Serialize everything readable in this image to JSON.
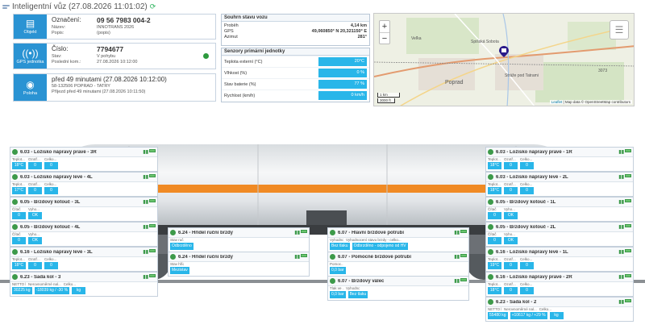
{
  "header": {
    "title": "Inteligentní vůz (27.08.2026 11:01:02)"
  },
  "wagon_info": {
    "tile_label": "Objekt",
    "main_key": "Označení:",
    "main_value": "09 56 7983 004-2",
    "rows": [
      {
        "key": "Název:",
        "value": "INNOTRANS 2026"
      },
      {
        "key": "Popis:",
        "value": "(popis)"
      }
    ]
  },
  "gps_info": {
    "tile_label": "GPS jednotka",
    "main_key": "Číslo:",
    "main_value": "7794677",
    "rows": [
      {
        "key": "Stav:",
        "value": "V pohybu"
      },
      {
        "key": "Poslední kom.:",
        "value": "27.08.2026 10:12:00"
      }
    ],
    "status_color": "#2d9a3d"
  },
  "position_info": {
    "tile_label": "Poloha",
    "main_value": "před 49 minutami (27.08.2026 10:12:00)",
    "rows": [
      {
        "value": "58-132506 POPRAD - TATRY"
      },
      {
        "value": "Příjezd před 49 minutami (27.08.2026 10:11:50)"
      }
    ]
  },
  "summary": {
    "title": "Souhrn stavu vozu",
    "rows": [
      {
        "key": "Proběh",
        "value": "4,14 km"
      },
      {
        "key": "GPS",
        "value": "49,060850° N 20,321150° E"
      },
      {
        "key": "Azimut",
        "value": "281°"
      }
    ]
  },
  "sensors": {
    "title": "Senzory primární jednotky",
    "rows": [
      {
        "key": "Teplota externí (°C)",
        "value": "20°C"
      },
      {
        "key": "Vlhkost (%)",
        "value": "0 %"
      },
      {
        "key": "Stav baterie (%)",
        "value": "77 %"
      },
      {
        "key": "Rychlost (km/h)",
        "value": "0 km/h"
      }
    ]
  },
  "map": {
    "zoom_in": "+",
    "zoom_out": "−",
    "labels": [
      "Veľka",
      "Spišská Sobota",
      "Poprad",
      "Stráže pod Tatrami",
      "3073"
    ],
    "scale_km": "1 km",
    "scale_ft": "3000 ft",
    "attrib_leaflet": "Leaflet",
    "attrib_rest": " | Map data © OpenStreetMap contributors"
  },
  "left_cards": [
    {
      "title": "6.03 - Ložisko nápravy pravé - 3R",
      "labels": [
        "Teplot...",
        "Ozotř...",
        "Celko..."
      ],
      "values": [
        "18°C",
        "0",
        "0"
      ]
    },
    {
      "title": "6.03 - Ložisko nápravy levé - 4L",
      "labels": [
        "Teplot...",
        "Ozotř...",
        "Celko..."
      ],
      "values": [
        "17°C",
        "0",
        "0"
      ]
    },
    {
      "title": "6.05 - Brzdový kotouč - 3L",
      "labels": [
        "Čítač",
        "Vyho..."
      ],
      "values": [
        "0",
        "OK"
      ]
    },
    {
      "title": "6.05 - Brzdový kotouč - 4L",
      "labels": [
        "Čítač",
        "Vyho..."
      ],
      "values": [
        "0",
        "OK"
      ]
    },
    {
      "title": "6.16 - Ložisko nápravy levé - 3L",
      "labels": [
        "Teplot...",
        "Ozotř...",
        "Celko..."
      ],
      "values": [
        "18°C",
        "0",
        "0"
      ]
    },
    {
      "title": "6.23 - Sada kol - 3",
      "labels": [
        "NETTO h...",
        "Nerovnoměrné nal...",
        "Celko..."
      ],
      "values": [
        "30225 kg",
        "-18039 kg / -30 %",
        "kg"
      ]
    }
  ],
  "right_cards": [
    {
      "title": "6.03 - Ložisko nápravy pravé - 1R",
      "labels": [
        "Teplot...",
        "Ozotř...",
        "Celko..."
      ],
      "values": [
        "18°C",
        "0",
        "0"
      ]
    },
    {
      "title": "6.03 - Ložisko nápravy levé - 2L",
      "labels": [
        "Teplot...",
        "Ozotř...",
        "Celko..."
      ],
      "values": [
        "18°C",
        "0",
        "0"
      ]
    },
    {
      "title": "6.05 - Brzdový kotouč - 1L",
      "labels": [
        "Čítač",
        "Vyho..."
      ],
      "values": [
        "0",
        "OK"
      ]
    },
    {
      "title": "6.05 - Brzdový kotouč - 2L",
      "labels": [
        "Čítač",
        "Vyho..."
      ],
      "values": [
        "0",
        "OK"
      ]
    },
    {
      "title": "6.16 - Ložisko nápravy levé - 1L",
      "labels": [
        "Teplot...",
        "Ozotř...",
        "Celko..."
      ],
      "values": [
        "19°C",
        "0",
        "0"
      ]
    },
    {
      "title": "6.16 - Ložisko nápravy pravé - 2R",
      "labels": [
        "Teplot...",
        "Ozotř...",
        "Celko..."
      ],
      "values": [
        "18°C",
        "0",
        "0"
      ]
    },
    {
      "title": "6.23 - Sada kol - 2",
      "labels": [
        "NETTO h...",
        "Nerovnoměrné nal...",
        "Celko..."
      ],
      "values": [
        "55480 kg",
        "+10617 kg / +29 %",
        "kg"
      ]
    }
  ],
  "center_cards": [
    {
      "title": "6.24 - Hřídel ruční brzdy",
      "labels": [
        "Stav ruč..."
      ],
      "values": [
        "Odbrzděno"
      ]
    },
    {
      "title": "6.24 - Hřídel ruční brzdy",
      "labels": [
        "Stav hříd..."
      ],
      "values": [
        "Mezistav"
      ]
    },
    {
      "title": "6.07 - Hlavní brzdové potrubí",
      "labels": [
        "Vyhodno...",
        "Vyhodnocení stavu brzdy - celko..."
      ],
      "values": [
        "Bez tlaku",
        "Odbrzděno - odpojeno od HV"
      ]
    },
    {
      "title": "6.07 - Pomocné brzdové potrubí",
      "labels": [
        "Pomoc..."
      ],
      "values": [
        "0,0 bar"
      ]
    },
    {
      "title": "6.07 - Brzdový válec",
      "labels": [
        "Tlak ve ...",
        "Vyhodno..."
      ],
      "values": [
        "0,0 bar",
        "Bez tlaku"
      ]
    }
  ],
  "colors": {
    "accent": "#29b6e9",
    "tile": "#2a93d3",
    "ok": "#3d9a4a",
    "stripe": "#f08a24"
  }
}
